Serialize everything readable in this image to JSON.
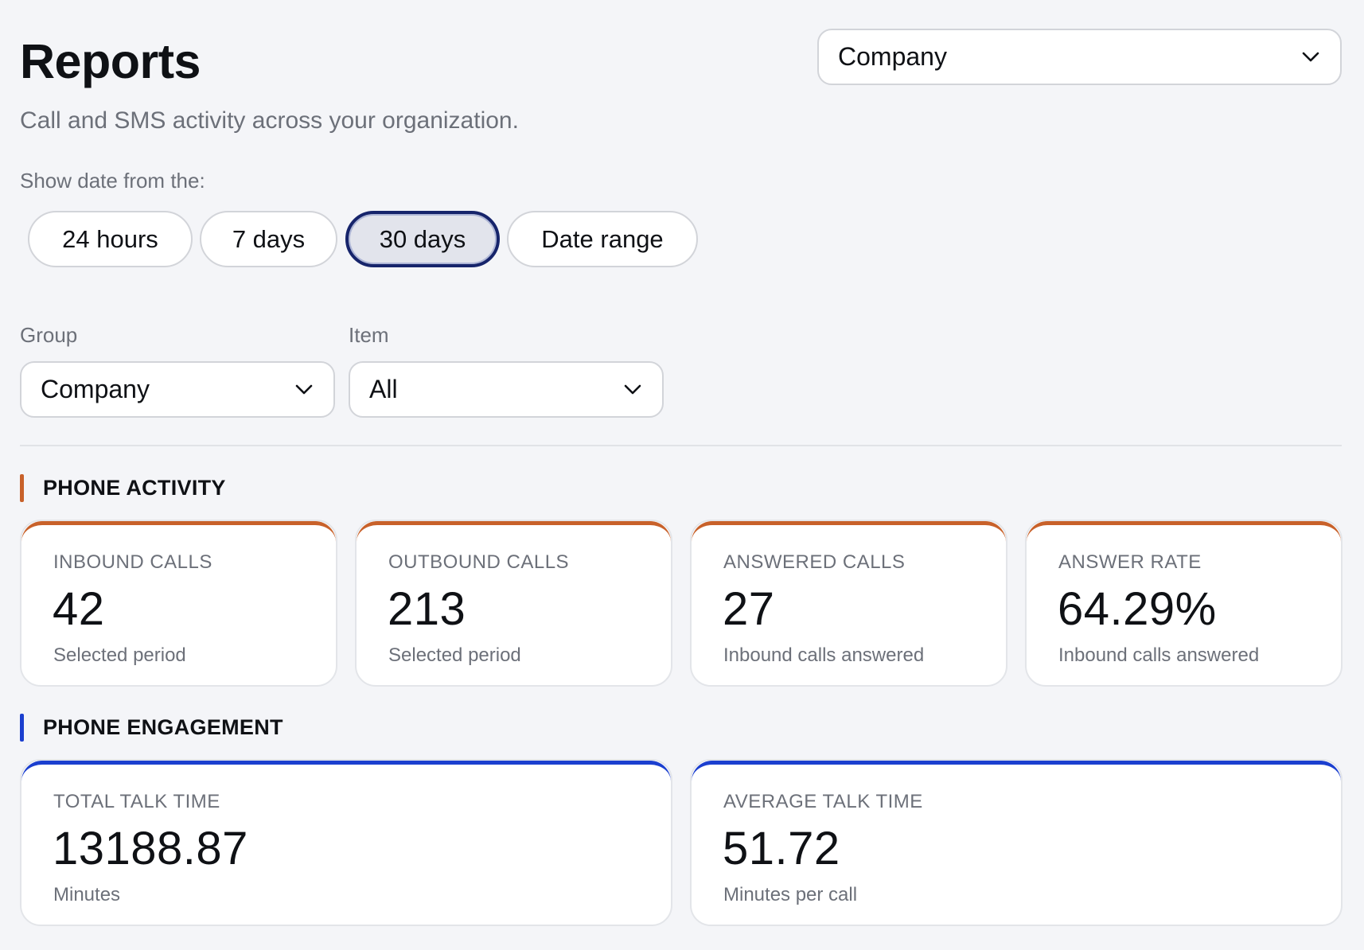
{
  "header": {
    "title": "Reports",
    "subtitle": "Call and SMS activity across your organization.",
    "scope_select": {
      "value": "Company",
      "icon": "chevron-down-icon"
    }
  },
  "date_filter": {
    "label": "Show date from the:",
    "options": [
      "24 hours",
      "7 days",
      "30 days",
      "Date range"
    ],
    "selected": "30 days"
  },
  "filters": {
    "group": {
      "label": "Group",
      "value": "Company",
      "icon": "chevron-down-icon"
    },
    "item": {
      "label": "Item",
      "value": "All",
      "icon": "chevron-down-icon"
    }
  },
  "sections": [
    {
      "title": "PHONE ACTIVITY",
      "accent_color": "#c8612a",
      "cards": [
        {
          "label": "INBOUND CALLS",
          "value": "42",
          "sub": "Selected period"
        },
        {
          "label": "OUTBOUND CALLS",
          "value": "213",
          "sub": "Selected period"
        },
        {
          "label": "ANSWERED CALLS",
          "value": "27",
          "sub": "Inbound calls answered"
        },
        {
          "label": "ANSWER RATE",
          "value": "64.29%",
          "sub": "Inbound calls answered"
        }
      ]
    },
    {
      "title": "PHONE ENGAGEMENT",
      "accent_color": "#1b3fcf",
      "cards": [
        {
          "label": "TOTAL TALK TIME",
          "value": "13188.87",
          "sub": "Minutes"
        },
        {
          "label": "AVERAGE TALK TIME",
          "value": "51.72",
          "sub": "Minutes per call"
        }
      ]
    }
  ]
}
